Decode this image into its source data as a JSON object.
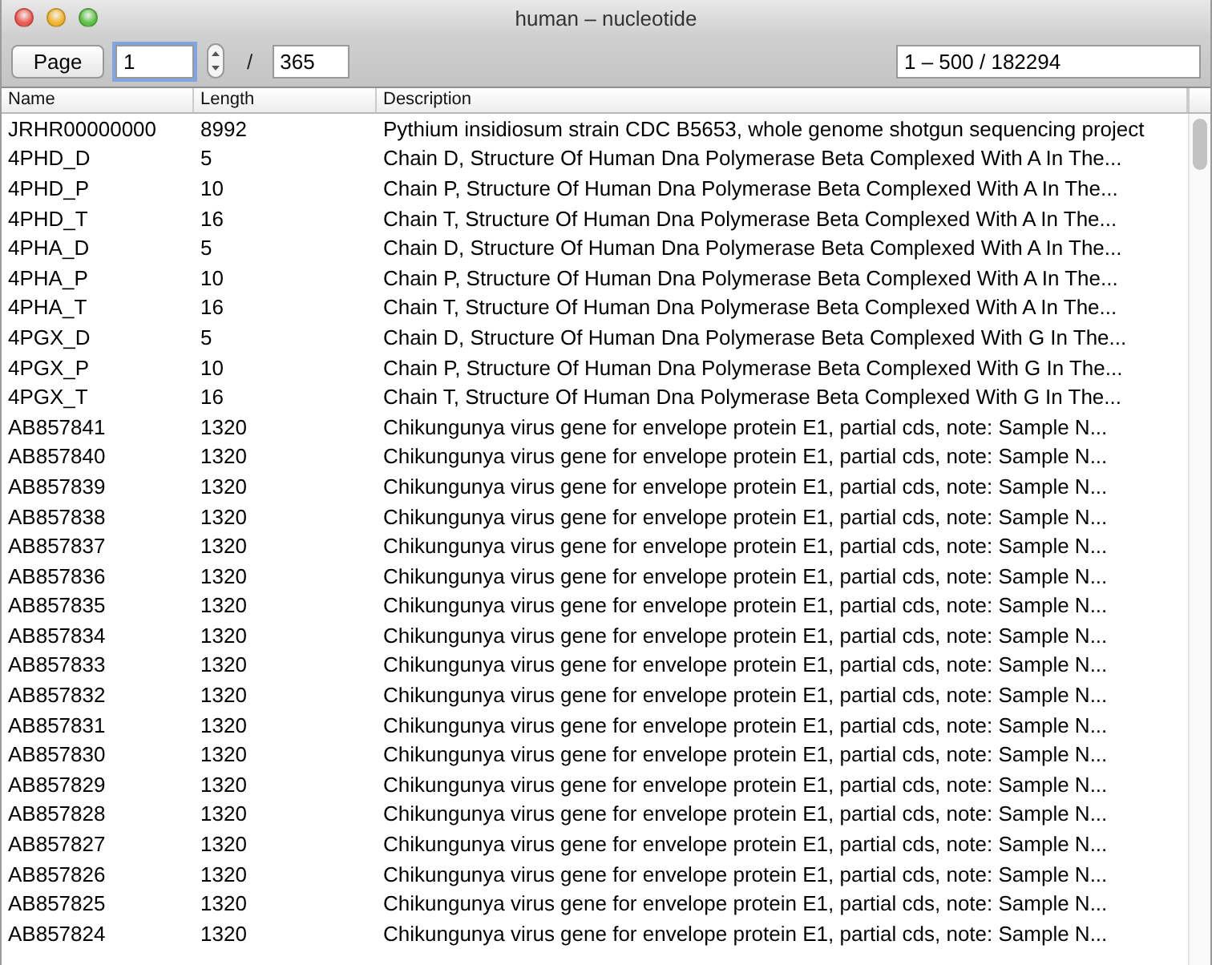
{
  "window": {
    "title": "human – nucleotide"
  },
  "toolbar": {
    "page_button": "Page",
    "page_field": "1",
    "separator": "/",
    "page_total": "365",
    "range": "1 – 500 / 182294"
  },
  "table": {
    "columns": [
      "Name",
      "Length",
      "Description"
    ],
    "rows": [
      [
        "JRHR00000000",
        "8992",
        "Pythium insidiosum strain CDC B5653, whole genome shotgun sequencing project"
      ],
      [
        "4PHD_D",
        "5",
        "Chain D, Structure Of Human Dna Polymerase Beta Complexed With A In The..."
      ],
      [
        "4PHD_P",
        "10",
        "Chain P, Structure Of Human Dna Polymerase Beta Complexed With A In The..."
      ],
      [
        "4PHD_T",
        "16",
        "Chain T, Structure Of Human Dna Polymerase Beta Complexed With A In The..."
      ],
      [
        "4PHA_D",
        "5",
        "Chain D, Structure Of Human Dna Polymerase Beta Complexed With A In The..."
      ],
      [
        "4PHA_P",
        "10",
        "Chain P, Structure Of Human Dna Polymerase Beta Complexed With A In The..."
      ],
      [
        "4PHA_T",
        "16",
        "Chain T, Structure Of Human Dna Polymerase Beta Complexed With A In The..."
      ],
      [
        "4PGX_D",
        "5",
        "Chain D, Structure Of Human Dna Polymerase Beta Complexed With G In The..."
      ],
      [
        "4PGX_P",
        "10",
        "Chain P, Structure Of Human Dna Polymerase Beta Complexed With G In The..."
      ],
      [
        "4PGX_T",
        "16",
        "Chain T, Structure Of Human Dna Polymerase Beta Complexed With G In The..."
      ],
      [
        "AB857841",
        "1320",
        "Chikungunya virus gene for envelope protein E1, partial cds, note: Sample N..."
      ],
      [
        "AB857840",
        "1320",
        "Chikungunya virus gene for envelope protein E1, partial cds, note: Sample N..."
      ],
      [
        "AB857839",
        "1320",
        "Chikungunya virus gene for envelope protein E1, partial cds, note: Sample N..."
      ],
      [
        "AB857838",
        "1320",
        "Chikungunya virus gene for envelope protein E1, partial cds, note: Sample N..."
      ],
      [
        "AB857837",
        "1320",
        "Chikungunya virus gene for envelope protein E1, partial cds, note: Sample N..."
      ],
      [
        "AB857836",
        "1320",
        "Chikungunya virus gene for envelope protein E1, partial cds, note: Sample N..."
      ],
      [
        "AB857835",
        "1320",
        "Chikungunya virus gene for envelope protein E1, partial cds, note: Sample N..."
      ],
      [
        "AB857834",
        "1320",
        "Chikungunya virus gene for envelope protein E1, partial cds, note: Sample N..."
      ],
      [
        "AB857833",
        "1320",
        "Chikungunya virus gene for envelope protein E1, partial cds, note: Sample N..."
      ],
      [
        "AB857832",
        "1320",
        "Chikungunya virus gene for envelope protein E1, partial cds, note: Sample N..."
      ],
      [
        "AB857831",
        "1320",
        "Chikungunya virus gene for envelope protein E1, partial cds, note: Sample N..."
      ],
      [
        "AB857830",
        "1320",
        "Chikungunya virus gene for envelope protein E1, partial cds, note: Sample N..."
      ],
      [
        "AB857829",
        "1320",
        "Chikungunya virus gene for envelope protein E1, partial cds, note: Sample N..."
      ],
      [
        "AB857828",
        "1320",
        "Chikungunya virus gene for envelope protein E1, partial cds, note: Sample N..."
      ],
      [
        "AB857827",
        "1320",
        "Chikungunya virus gene for envelope protein E1, partial cds, note: Sample N..."
      ],
      [
        "AB857826",
        "1320",
        "Chikungunya virus gene for envelope protein E1, partial cds, note: Sample N..."
      ],
      [
        "AB857825",
        "1320",
        "Chikungunya virus gene for envelope protein E1, partial cds, note: Sample N..."
      ],
      [
        "AB857824",
        "1320",
        "Chikungunya virus gene for envelope protein E1, partial cds, note: Sample N..."
      ]
    ]
  }
}
